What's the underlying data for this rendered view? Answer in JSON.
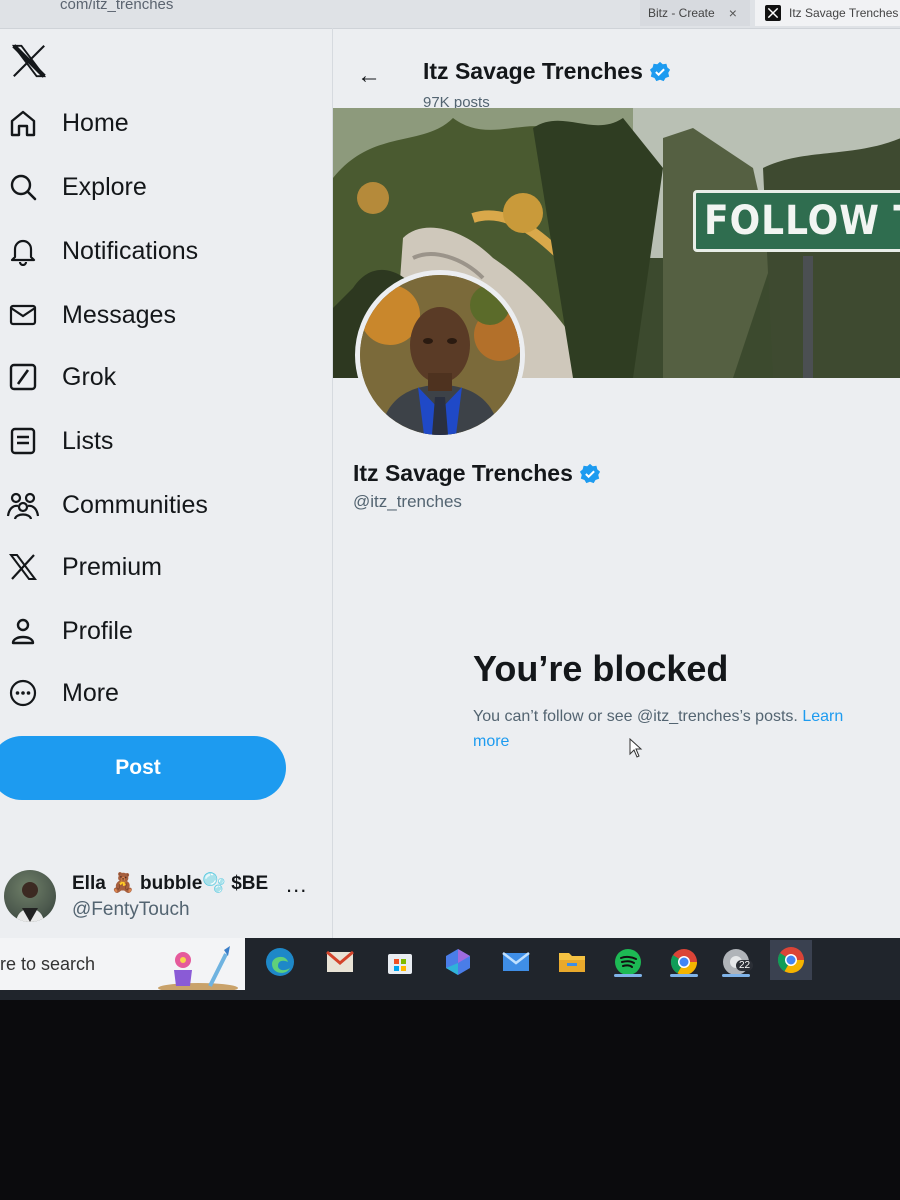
{
  "browser": {
    "url_fragment": "com/itz_trenches",
    "tabs": [
      {
        "title": "Bitz - Create",
        "close": "×"
      },
      {
        "title": "Itz Savage Trenches"
      }
    ]
  },
  "sidebar": {
    "items": [
      {
        "label": "Home",
        "icon": "home-icon"
      },
      {
        "label": "Explore",
        "icon": "search-icon"
      },
      {
        "label": "Notifications",
        "icon": "bell-icon"
      },
      {
        "label": "Messages",
        "icon": "envelope-icon"
      },
      {
        "label": "Grok",
        "icon": "grok-icon"
      },
      {
        "label": "Lists",
        "icon": "list-icon"
      },
      {
        "label": "Communities",
        "icon": "communities-icon"
      },
      {
        "label": "Premium",
        "icon": "x-icon"
      },
      {
        "label": "Profile",
        "icon": "person-icon"
      },
      {
        "label": "More",
        "icon": "more-circle-icon"
      }
    ],
    "post_label": "Post",
    "account": {
      "display_name": "Ella 🧸 bubble🫧 $BE",
      "handle": "@FentyTouch",
      "more": "..."
    }
  },
  "profile": {
    "header_name": "Itz Savage Trenches",
    "post_count": "97K posts",
    "back": "←",
    "banner_sign": "FOLLOW THAT DREAM",
    "name": "Itz Savage Trenches",
    "handle": "@itz_trenches"
  },
  "blocked": {
    "title": "You’re blocked",
    "message": "You can’t follow or see @itz_trenches’s posts. ",
    "link": "Learn more"
  },
  "taskbar": {
    "search_text": "re to search",
    "badge": "22",
    "icons": [
      "edge-icon",
      "mail-icon",
      "store-icon",
      "copilot-icon",
      "outlook-icon",
      "file-explorer-icon",
      "spotify-icon",
      "chrome-icon",
      "chrome-profile-icon",
      "chrome-icon-alt"
    ]
  },
  "colors": {
    "accent": "#1d9bf0",
    "text": "#14171a",
    "muted": "#536471"
  }
}
